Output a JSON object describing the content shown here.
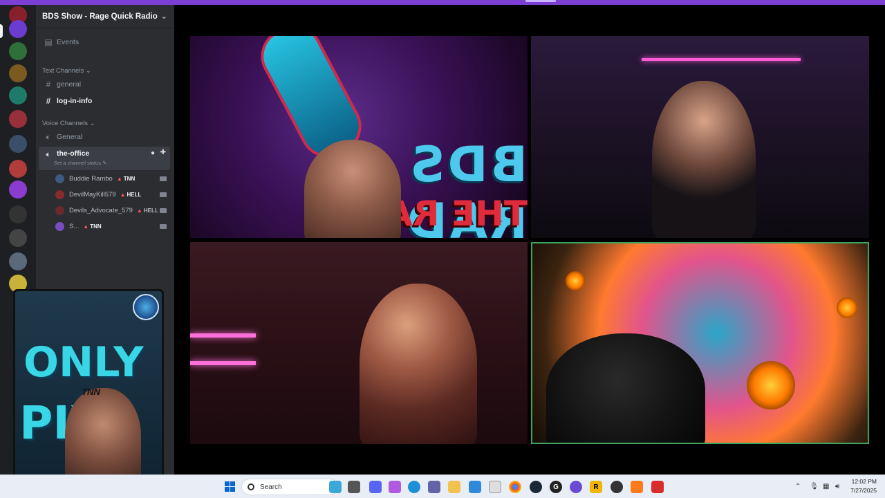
{
  "guild": {
    "name": "BDS Show - Rage Quick Radio"
  },
  "sidebar": {
    "events_label": "Events",
    "text_category": "Text Channels",
    "voice_category": "Voice Channels",
    "text_channels": [
      "general",
      "log-in-info"
    ],
    "voice_channels": [
      "General",
      "the-office"
    ],
    "active_channel_status_placeholder": "Set a channel status",
    "voice_users": [
      {
        "name": "Buddie Rambo",
        "tag": "TNN",
        "avatar_color": "#3d5a80"
      },
      {
        "name": "DevilMayKill579",
        "tag": "HELL",
        "avatar_color": "#8a2b2b"
      },
      {
        "name": "Devils_Advocate_579",
        "tag": "HELL",
        "avatar_color": "#6b2a2a"
      },
      {
        "name": "S...",
        "tag": "TNN",
        "avatar_color": "#7a4cc2"
      }
    ]
  },
  "stage": {
    "tile1_overlay_line1": "BDS RADIO",
    "tile1_overlay_line2": "THE RAGE SHOW"
  },
  "pip": {
    "line1": "ONLY",
    "line2": "PIX",
    "tnn": "TNN"
  },
  "taskbar": {
    "search_label": "Search",
    "time": "12:02 PM",
    "date": "7/27/2025"
  },
  "colors": {
    "accent_top": "#7b3fd4",
    "speaking_border": "#3ba55c",
    "sidebar_bg": "#2b2d31",
    "server_rail_bg": "#1e1f22"
  }
}
